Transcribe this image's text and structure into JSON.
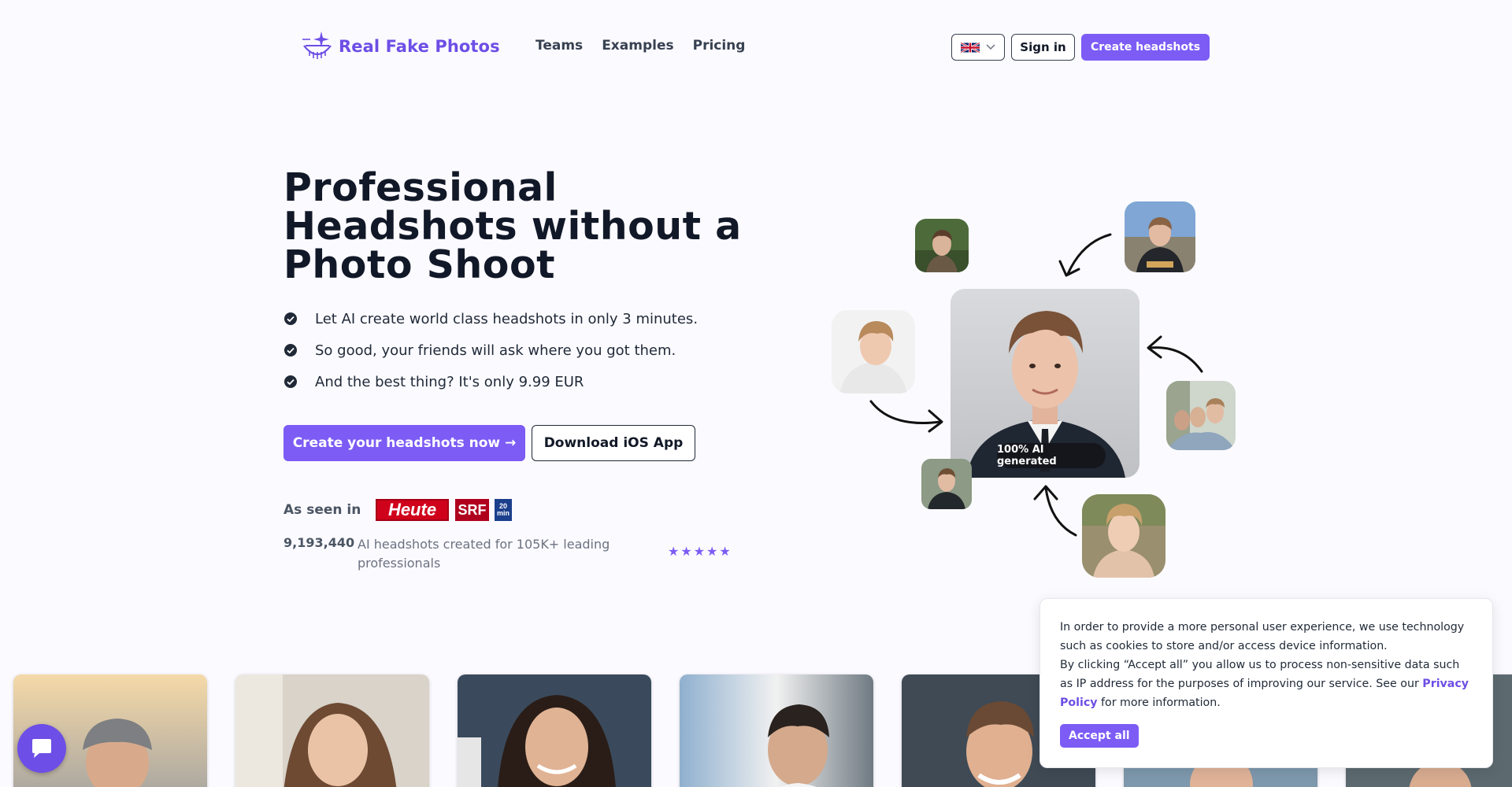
{
  "brand": {
    "name": "Real Fake Photos",
    "color": "#6d4ee6"
  },
  "nav": [
    {
      "label": "Teams"
    },
    {
      "label": "Examples"
    },
    {
      "label": "Pricing"
    }
  ],
  "header": {
    "language_icon": "uk-flag-icon",
    "sign_in_label": "Sign in",
    "create_label": "Create headshots"
  },
  "hero": {
    "title": "Professional Headshots without a Photo Shoot",
    "bullets": [
      "Let AI create world class headshots in only 3 minutes.",
      "So good, your friends will ask where you got them.",
      "And the best thing? It's only 9.99 EUR"
    ],
    "cta_primary": "Create your headshots now →",
    "cta_secondary": "Download iOS App",
    "seen_in_label": "As seen in",
    "press": {
      "heute": "Heute",
      "srf": "SRF",
      "twenty_min": "20 min"
    },
    "counter_value": "9,193,440",
    "counter_text": "AI headshots created for 105K+ leading professionals",
    "rating_stars": 5,
    "ai_badge": "100% AI generated"
  },
  "cookie": {
    "line1": "In order to provide a more personal user experience, we use technology such as cookies to store and/or access device information.",
    "line2_prefix": "By clicking “Accept all” you allow us to process non-sensitive data such as IP address for the purposes of improving our service. See our ",
    "privacy_link": "Privacy Policy",
    "line2_suffix": " for more information.",
    "accept_label": "Accept all"
  },
  "colors": {
    "accent": "#7c5cf5",
    "text_dark": "#111827",
    "background": "#fbfaff"
  }
}
